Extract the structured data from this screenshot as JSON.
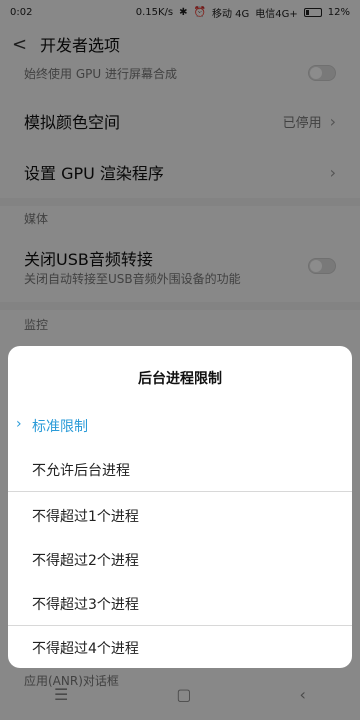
{
  "status": {
    "time": "0:02",
    "speed": "0.15K/s",
    "carrier1": "移动 4G",
    "carrier2": "电信4G+",
    "battery": "12%"
  },
  "header": {
    "title": "开发者选项"
  },
  "background": {
    "gpu_caption": "始终使用 GPU 进行屏幕合成",
    "color_space_label": "模拟颜色空间",
    "color_space_value": "已停用",
    "gpu_renderer_label": "设置 GPU 渲染程序",
    "media_section": "媒体",
    "usb_audio_title": "关闭USB音频转接",
    "usb_audio_sub": "关闭自动转接至USB音频外围设备的功能",
    "monitor_section": "监控",
    "hidden_row_label": "应用(ANR)对话框"
  },
  "dialog": {
    "title": "后台进程限制",
    "options": [
      "标准限制",
      "不允许后台进程",
      "不得超过1个进程",
      "不得超过2个进程",
      "不得超过3个进程",
      "不得超过4个进程"
    ],
    "selected_index": 0
  },
  "colors": {
    "accent": "#2a9bd8"
  }
}
